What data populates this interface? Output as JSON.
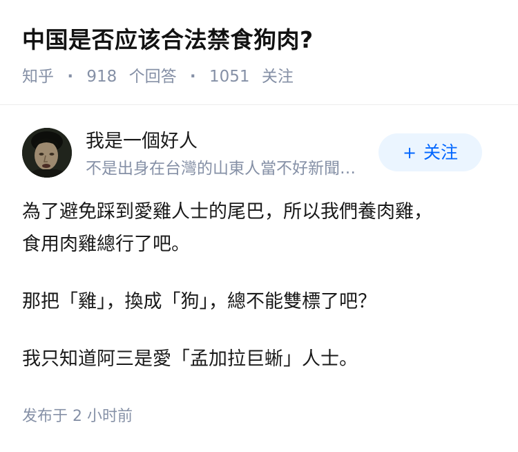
{
  "question": {
    "title": "中国是否应该合法禁食狗肉?",
    "source": "知乎",
    "separator": "·",
    "answer_count": "918",
    "answer_label": "个回答",
    "follower_count": "1051",
    "follower_label": "关注"
  },
  "author": {
    "name": "我是一個好人",
    "bio": "不是出身在台灣的山東人當不好新聞主播",
    "follow_label": "关注",
    "follow_icon": "plus-icon",
    "follow_color": "#0066ff",
    "follow_bg": "#ebf5ff"
  },
  "answer": {
    "paragraphs": [
      [
        "為了避免踩到愛雞人士的尾巴，所以我們養肉雞，",
        "食用肉雞總行了吧。"
      ],
      [
        "那把「雞」，換成「狗」，總不能雙標了吧？"
      ],
      [
        "我只知道阿三是愛「孟加拉巨蜥」人士。"
      ]
    ],
    "published_label": "发布于",
    "published_time": "2 小时前"
  }
}
